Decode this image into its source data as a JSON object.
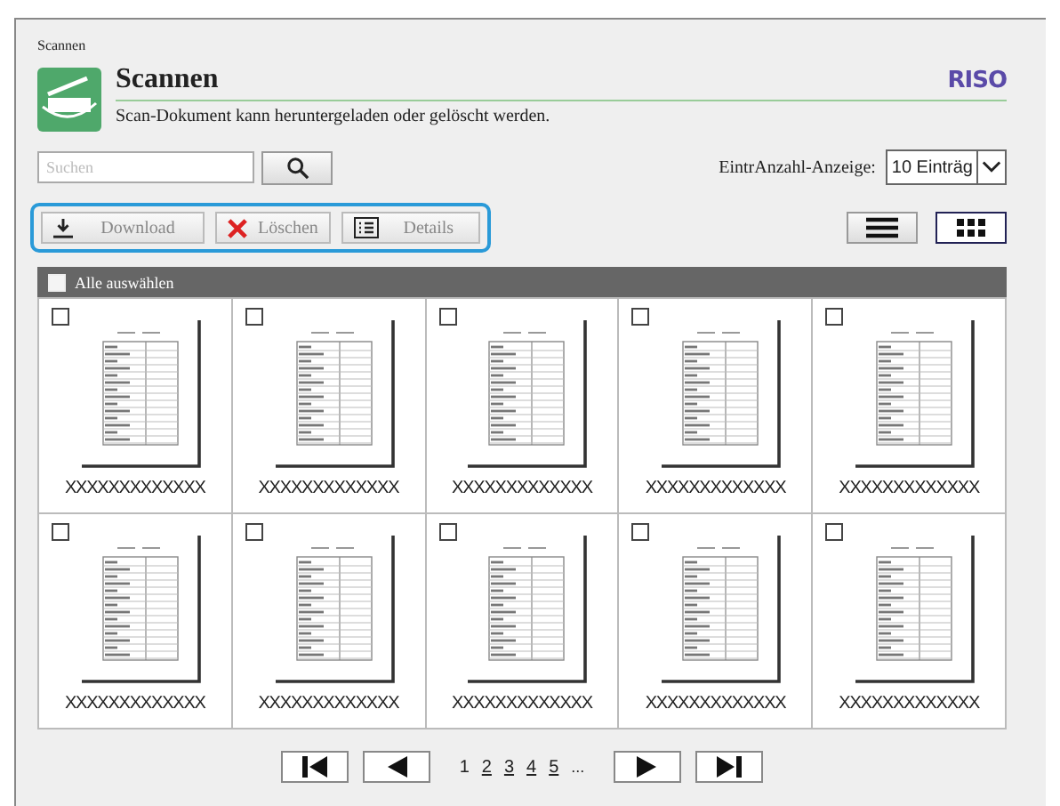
{
  "breadcrumb": "Scannen",
  "header": {
    "title": "Scannen",
    "description": "Scan-Dokument kann heruntergeladen oder gelöscht werden.",
    "logo": "RISO"
  },
  "search": {
    "placeholder": "Suchen"
  },
  "entries": {
    "label": "EintrAnzahl-Anzeige:",
    "value": "10 Einträg"
  },
  "actions": [
    {
      "kind": "download",
      "label": "Download",
      "disabled": true
    },
    {
      "kind": "delete",
      "label": "Löschen",
      "disabled": true
    },
    {
      "kind": "details",
      "label": "Details",
      "disabled": true
    }
  ],
  "views": [
    {
      "kind": "list",
      "selected": false
    },
    {
      "kind": "grid",
      "selected": true
    }
  ],
  "select_all": {
    "label": "Alle auswählen",
    "checked": false
  },
  "files": [
    {
      "name": "XXXXXXXXXXXXX",
      "checked": false
    },
    {
      "name": "XXXXXXXXXXXXX",
      "checked": false
    },
    {
      "name": "XXXXXXXXXXXXX",
      "checked": false
    },
    {
      "name": "XXXXXXXXXXXXX",
      "checked": false
    },
    {
      "name": "XXXXXXXXXXXXX",
      "checked": false
    },
    {
      "name": "XXXXXXXXXXXXX",
      "checked": false
    },
    {
      "name": "XXXXXXXXXXXXX",
      "checked": false
    },
    {
      "name": "XXXXXXXXXXXXX",
      "checked": false
    },
    {
      "name": "XXXXXXXXXXXXX",
      "checked": false
    },
    {
      "name": "XXXXXXXXXXXXX",
      "checked": false
    }
  ],
  "pagination": {
    "pages": [
      {
        "label": "1",
        "selected": true
      },
      {
        "label": "2",
        "selected": false
      },
      {
        "label": "3",
        "selected": false
      },
      {
        "label": "4",
        "selected": false
      },
      {
        "label": "5",
        "selected": false
      }
    ],
    "more": "..."
  }
}
